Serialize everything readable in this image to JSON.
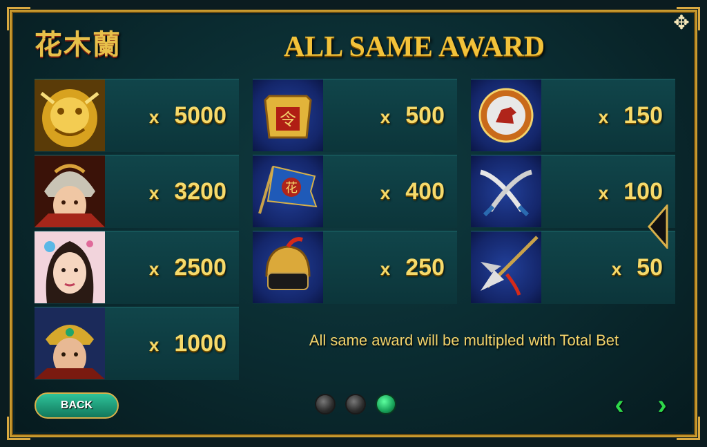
{
  "header": {
    "logo_text": "花木蘭",
    "title": "ALL SAME AWARD",
    "move_icon": "move-arrows-icon"
  },
  "paytable": {
    "column1": [
      {
        "symbol": "golden-dragon",
        "multiplier": "5000"
      },
      {
        "symbol": "warrior-helmet-woman",
        "multiplier": "3200"
      },
      {
        "symbol": "lady-portrait",
        "multiplier": "2500"
      },
      {
        "symbol": "male-warrior",
        "multiplier": "1000"
      }
    ],
    "column2": [
      {
        "symbol": "command-token",
        "multiplier": "500"
      },
      {
        "symbol": "battle-flag",
        "multiplier": "400"
      },
      {
        "symbol": "golden-helmet",
        "multiplier": "250"
      }
    ],
    "column3": [
      {
        "symbol": "horse-shield",
        "multiplier": "150"
      },
      {
        "symbol": "crossed-swords",
        "multiplier": "100"
      },
      {
        "symbol": "halberd",
        "multiplier": "50"
      }
    ],
    "x_label": "x"
  },
  "note": "All same award will be multipled with Total Bet",
  "footer": {
    "back_label": "BACK",
    "pages": [
      false,
      false,
      true
    ],
    "prev_icon": "chevron-left-icon",
    "next_icon": "chevron-right-icon"
  },
  "colors": {
    "gold": "#f2c23a",
    "accent_green": "#2ed84a"
  }
}
